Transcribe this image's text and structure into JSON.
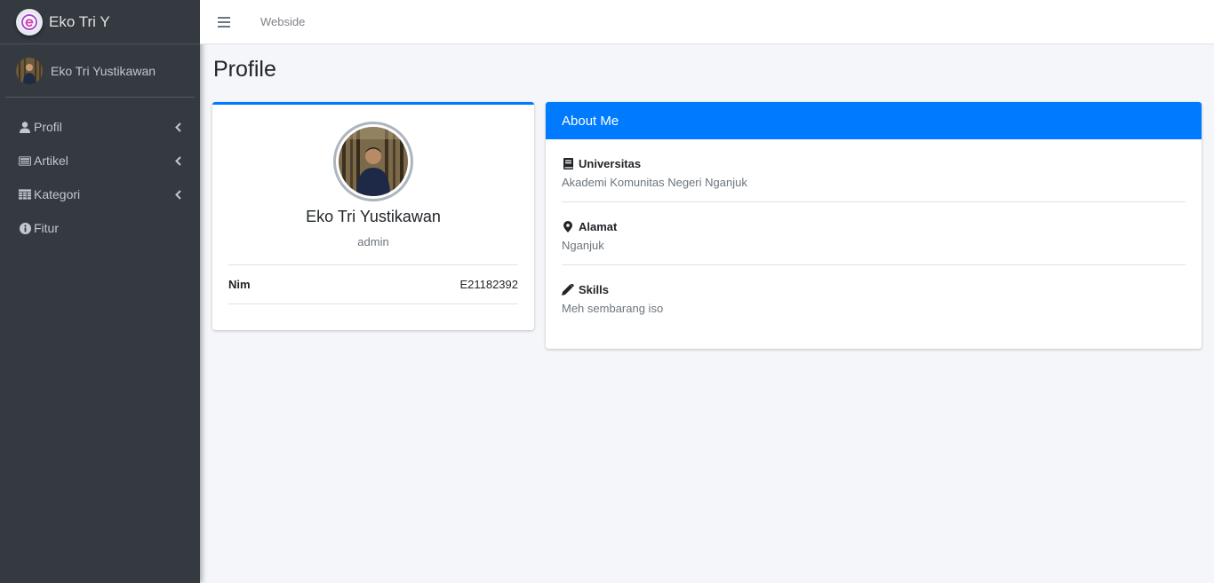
{
  "brand": {
    "title": "Eko Tri Y"
  },
  "user": {
    "name": "Eko Tri Yustikawan"
  },
  "sidebar": {
    "items": [
      {
        "label": "Profil",
        "icon": "user-icon",
        "has_submenu": true
      },
      {
        "label": "Artikel",
        "icon": "newspaper-icon",
        "has_submenu": true
      },
      {
        "label": "Kategori",
        "icon": "table-icon",
        "has_submenu": true
      },
      {
        "label": "Fitur",
        "icon": "info-circle-icon",
        "has_submenu": false
      }
    ]
  },
  "navbar": {
    "link": "Webside"
  },
  "page": {
    "title": "Profile"
  },
  "profile": {
    "name": "Eko Tri Yustikawan",
    "role": "admin",
    "fields": [
      {
        "label": "Nim",
        "value": "E21182392"
      }
    ]
  },
  "about": {
    "title": "About Me",
    "sections": [
      {
        "label": "Universitas",
        "value": "Akademi Komunitas Negeri Nganjuk",
        "icon": "book-icon"
      },
      {
        "label": "Alamat",
        "value": "Nganjuk",
        "icon": "map-marker-icon"
      },
      {
        "label": "Skills",
        "value": "Meh sembarang iso",
        "icon": "pencil-icon"
      }
    ]
  },
  "colors": {
    "sidebar": "#343a40",
    "primary": "#007bff",
    "background": "#f4f6f9"
  }
}
